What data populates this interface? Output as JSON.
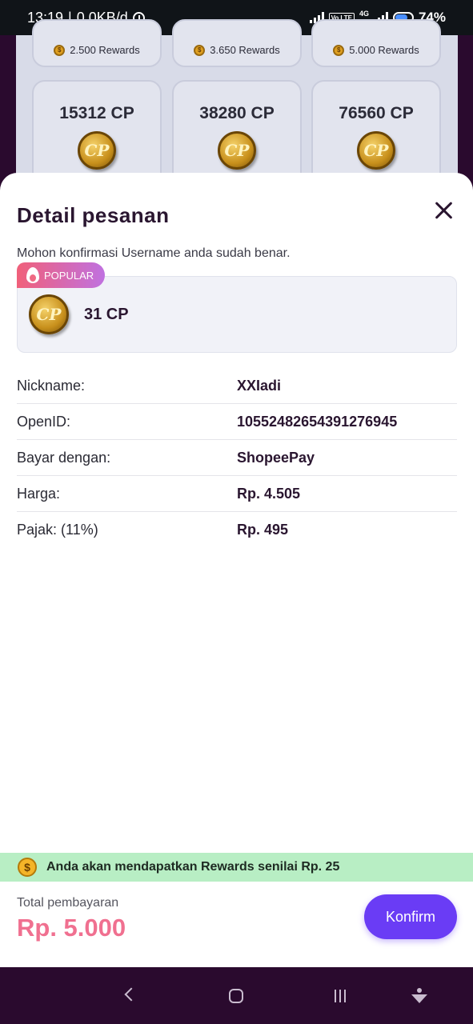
{
  "status_bar": {
    "time": "13:19",
    "separator": "|",
    "net_speed": "0,0KB/d",
    "network_type": "4G",
    "lte_badge": "Vo LTE",
    "battery": "74%"
  },
  "background": {
    "rewards_row": [
      {
        "label": "2.500 Rewards"
      },
      {
        "label": "3.650 Rewards"
      },
      {
        "label": "5.000 Rewards"
      }
    ],
    "cp_cards": [
      {
        "amount": "15312 CP",
        "coin": "CP"
      },
      {
        "amount": "38280 CP",
        "coin": "CP"
      },
      {
        "amount": "76560 CP",
        "coin": "CP"
      }
    ]
  },
  "sheet": {
    "title": "Detail pesanan",
    "subtitle": "Mohon konfirmasi Username anda sudah benar.",
    "badge": "POPULAR",
    "product": {
      "coin": "CP",
      "name": "31 CP"
    },
    "rows": [
      {
        "label": "Nickname:",
        "value": "XXIadi"
      },
      {
        "label": "OpenID:",
        "value": "10552482654391276945"
      },
      {
        "label": "Bayar dengan:",
        "value": "ShopeePay"
      },
      {
        "label": "Harga:",
        "value": "Rp. 4.505"
      },
      {
        "label": "Pajak: (11%)",
        "value": "Rp. 495"
      }
    ],
    "rewards_banner": "Anda akan mendapatkan Rewards senilai Rp. 25",
    "rewards_icon": "$",
    "total_label": "Total pembayaran",
    "total_amount": "Rp. 5.000",
    "confirm_label": "Konfirm"
  },
  "colors": {
    "accent": "#6a3cf5",
    "total": "#f07090",
    "banner": "#b8eec4",
    "nav_bg": "#2a0a2e"
  },
  "icons": [
    "alarm-icon",
    "signal-icon",
    "battery-icon",
    "coin-icon",
    "close-icon",
    "flame-icon",
    "dollar-coin-icon",
    "nav-back-icon",
    "nav-home-icon",
    "nav-recents-icon",
    "nav-assist-icon"
  ]
}
